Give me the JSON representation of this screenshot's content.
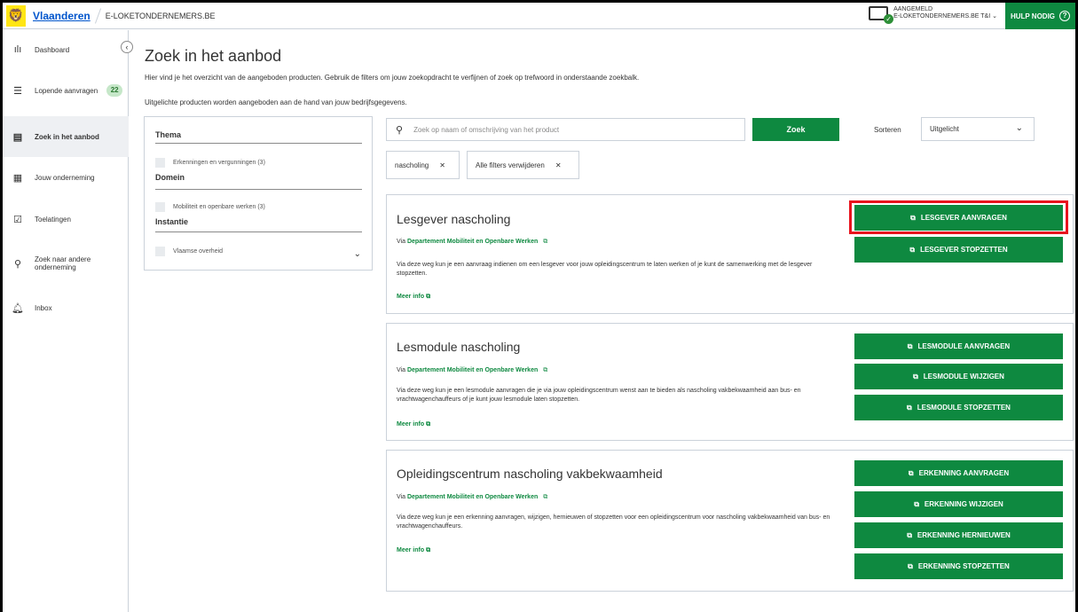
{
  "topbar": {
    "brand": "Vlaanderen",
    "site": "E-LOKETONDERNEMERS.BE",
    "user_status": "AANGEMELD",
    "user_name": "E-LOKETONDERNEMERS.BE T&I",
    "help_label": "HULP NODIG"
  },
  "sidebar": {
    "items": [
      {
        "label": "Dashboard",
        "icon": "bar-chart-icon"
      },
      {
        "label": "Lopende aanvragen",
        "icon": "list-icon",
        "badge": "22"
      },
      {
        "label": "Zoek in het aanbod",
        "icon": "document-icon"
      },
      {
        "label": "Jouw onderneming",
        "icon": "building-icon"
      },
      {
        "label": "Toelatingen",
        "icon": "check-envelope-icon"
      },
      {
        "label": "Zoek naar andere onderneming",
        "icon": "search-icon"
      },
      {
        "label": "Inbox",
        "icon": "bell-icon"
      }
    ]
  },
  "main": {
    "title": "Zoek in het aanbod",
    "intro1": "Hier vind je het overzicht van de aangeboden producten. Gebruik de filters om jouw zoekopdracht te verfijnen of zoek op trefwoord in onderstaande zoekbalk.",
    "intro2": "Uitgelichte producten worden aangeboden aan de hand van jouw bedrijfsgegevens."
  },
  "filters": {
    "thema": "Thema",
    "thema_option": "Erkenningen en vergunningen  (3)",
    "domein": "Domein",
    "domein_option": "Mobiliteit en openbare werken  (3)",
    "instantie": "Instantie",
    "instantie_option": "Vlaamse overheid"
  },
  "search": {
    "placeholder": "Zoek op naam of omschrijving van het product",
    "button": "Zoek",
    "sort_label": "Sorteren",
    "sort_value": "Uitgelicht"
  },
  "chips": {
    "active": "nascholing",
    "clear": "Alle filters verwijderen"
  },
  "cards": [
    {
      "title": "Lesgever nascholing",
      "via_prefix": "Via",
      "via_link": "Departement Mobiliteit en Openbare Werken",
      "desc": "Via deze weg kun je een aanvraag indienen om een lesgever voor jouw opleidingscentrum te laten werken of je kunt de samenwerking met de lesgever stopzetten.",
      "more": "Meer info",
      "actions": [
        "LESGEVER AANVRAGEN",
        "LESGEVER STOPZETTEN"
      ]
    },
    {
      "title": "Lesmodule nascholing",
      "via_prefix": "Via",
      "via_link": "Departement Mobiliteit en Openbare Werken",
      "desc": "Via deze weg kun je een lesmodule aanvragen die je via jouw opleidingscentrum wenst aan te bieden als nascholing vakbekwaamheid aan bus- en vrachtwagenchauffeurs of je kunt jouw lesmodule laten stopzetten.",
      "more": "Meer info",
      "actions": [
        "LESMODULE AANVRAGEN",
        "LESMODULE WIJZIGEN",
        "LESMODULE STOPZETTEN"
      ]
    },
    {
      "title": "Opleidingscentrum nascholing vakbekwaamheid",
      "via_prefix": "Via",
      "via_link": "Departement Mobiliteit en Openbare Werken",
      "desc": "Via deze weg kun je een erkenning aanvragen, wijzigen, hernieuwen of stopzetten voor een opleidingscentrum voor nascholing vakbekwaamheid van bus- en vrachtwagenchauffeurs.",
      "more": "Meer info",
      "actions": [
        "ERKENNING AANVRAGEN",
        "ERKENNING WIJZIGEN",
        "ERKENNING HERNIEUWEN",
        "ERKENNING STOPZETTEN"
      ]
    }
  ],
  "colors": {
    "accent_green": "#0e8940",
    "highlight_red": "#e8141e",
    "brand_yellow": "#ffe615"
  }
}
